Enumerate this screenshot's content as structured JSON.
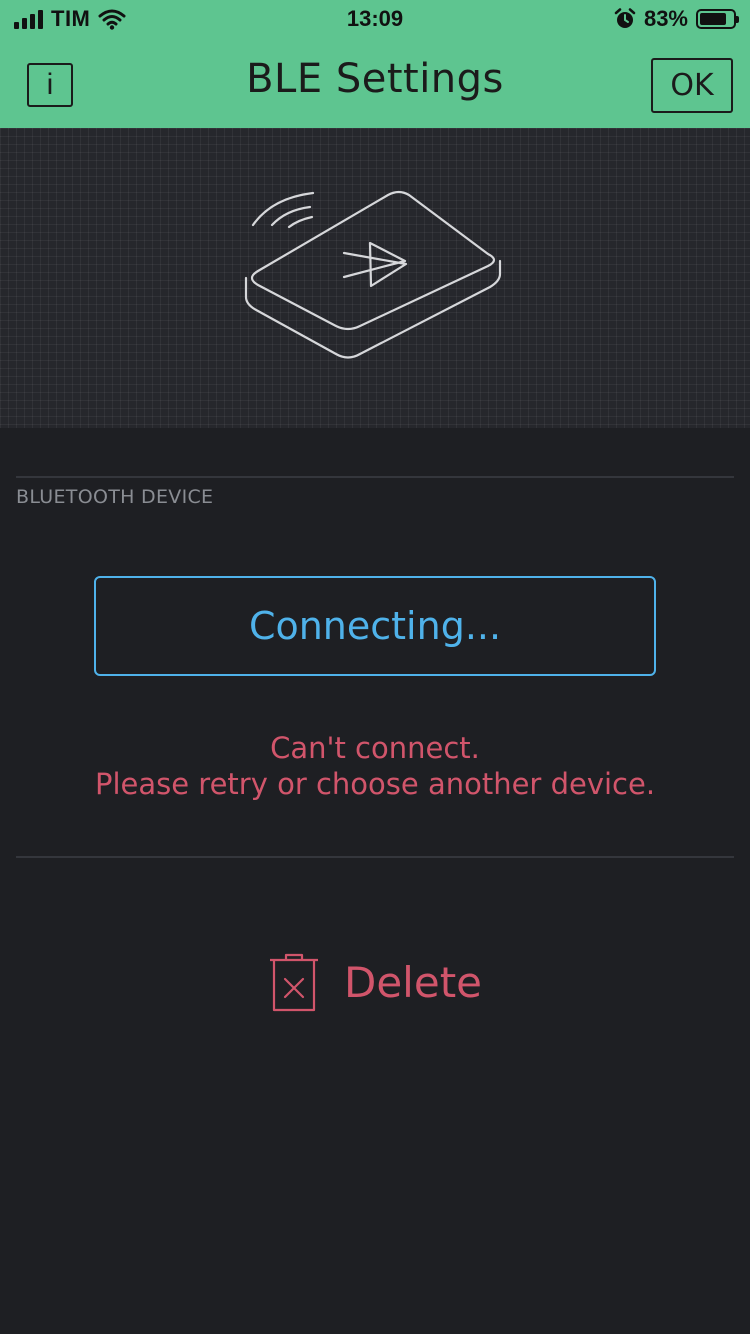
{
  "status_bar": {
    "carrier": "TIM",
    "time": "13:09",
    "battery_percent": "83%",
    "battery_level": 0.83,
    "icons": [
      "signal-icon",
      "wifi-icon",
      "alarm-icon",
      "battery-icon"
    ]
  },
  "nav": {
    "info_label": "i",
    "title": "BLE Settings",
    "ok_label": "OK"
  },
  "section": {
    "label": "BLUETOOTH DEVICE"
  },
  "connect": {
    "label": "Connecting..."
  },
  "error": {
    "line1": "Can't connect.",
    "line2": "Please retry or choose another device."
  },
  "actions": {
    "delete_label": "Delete"
  },
  "colors": {
    "header": "#5ec590",
    "background": "#1e1f23",
    "accent_blue": "#4fb2ea",
    "error_red": "#d1556b"
  }
}
